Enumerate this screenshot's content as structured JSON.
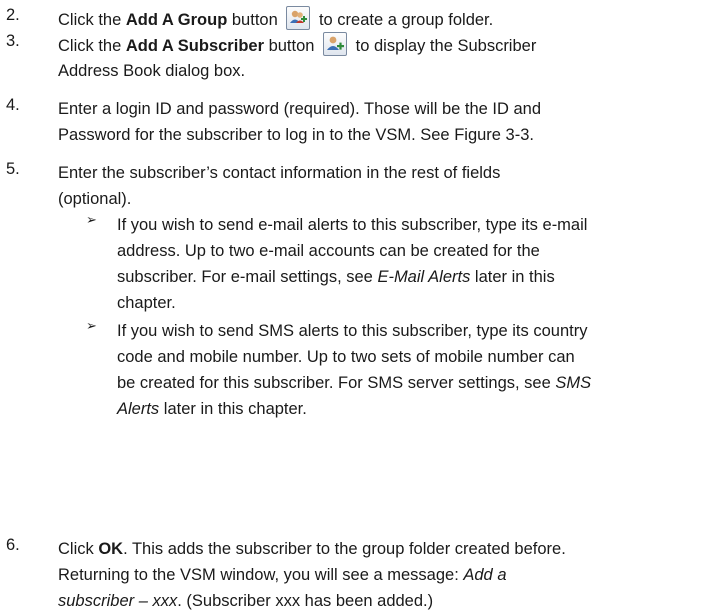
{
  "steps": [
    {
      "number": "2.",
      "lines": [
        {
          "pre": "Click the ",
          "bold": "Add A Group",
          "post": " button",
          "icon": "add-group-icon",
          "tail": " to create a group folder."
        }
      ]
    },
    {
      "number": "3.",
      "lines": [
        {
          "pre": "Click the ",
          "bold": "Add A Subscriber",
          "post": " button",
          "icon": "add-subscriber-icon",
          "tail": " to display the Subscriber"
        },
        {
          "text": "Address Book dialog box."
        }
      ]
    },
    {
      "number": "4.",
      "lines": [
        {
          "text": "Enter a login ID and password (required). Those will be the ID and"
        },
        {
          "text": "Password for the subscriber to log in to the VSM. See Figure 3-3."
        }
      ]
    },
    {
      "number": "5.",
      "lines": [
        {
          "text": "Enter the subscriber’s contact information in the rest of fields"
        },
        {
          "text": "(optional)."
        }
      ],
      "bullets": [
        {
          "marker": "➢",
          "lines": [
            "If you wish to send e-mail alerts to this subscriber, type its e-mail",
            "address. Up to two e-mail accounts can be created for the",
            "subscriber. For e-mail settings, see ",
            "chapter."
          ],
          "italic_ref": "E-Mail Alerts",
          "italic_after": " later in this"
        },
        {
          "marker": "➢",
          "lines": [
            "If you wish to send SMS alerts to this subscriber, type its country",
            "code and mobile number. Up to two sets of mobile number can",
            "be created for this subscriber. For SMS server settings, see "
          ],
          "italic_ref_a": "SMS",
          "italic_ref_b": "Alerts",
          "tail": " later in this chapter."
        }
      ]
    },
    {
      "number": "6.",
      "line1_pre": "Click ",
      "line1_bold": "OK",
      "line1_post": ". This adds the subscriber to the group folder created before.",
      "line2_pre": "Returning to the VSM window, you will see a message: ",
      "line2_italic": "Add a",
      "line3_italic": "subscriber – xxx",
      "line3_post": ". (Subscriber xxx has been added.)"
    }
  ]
}
